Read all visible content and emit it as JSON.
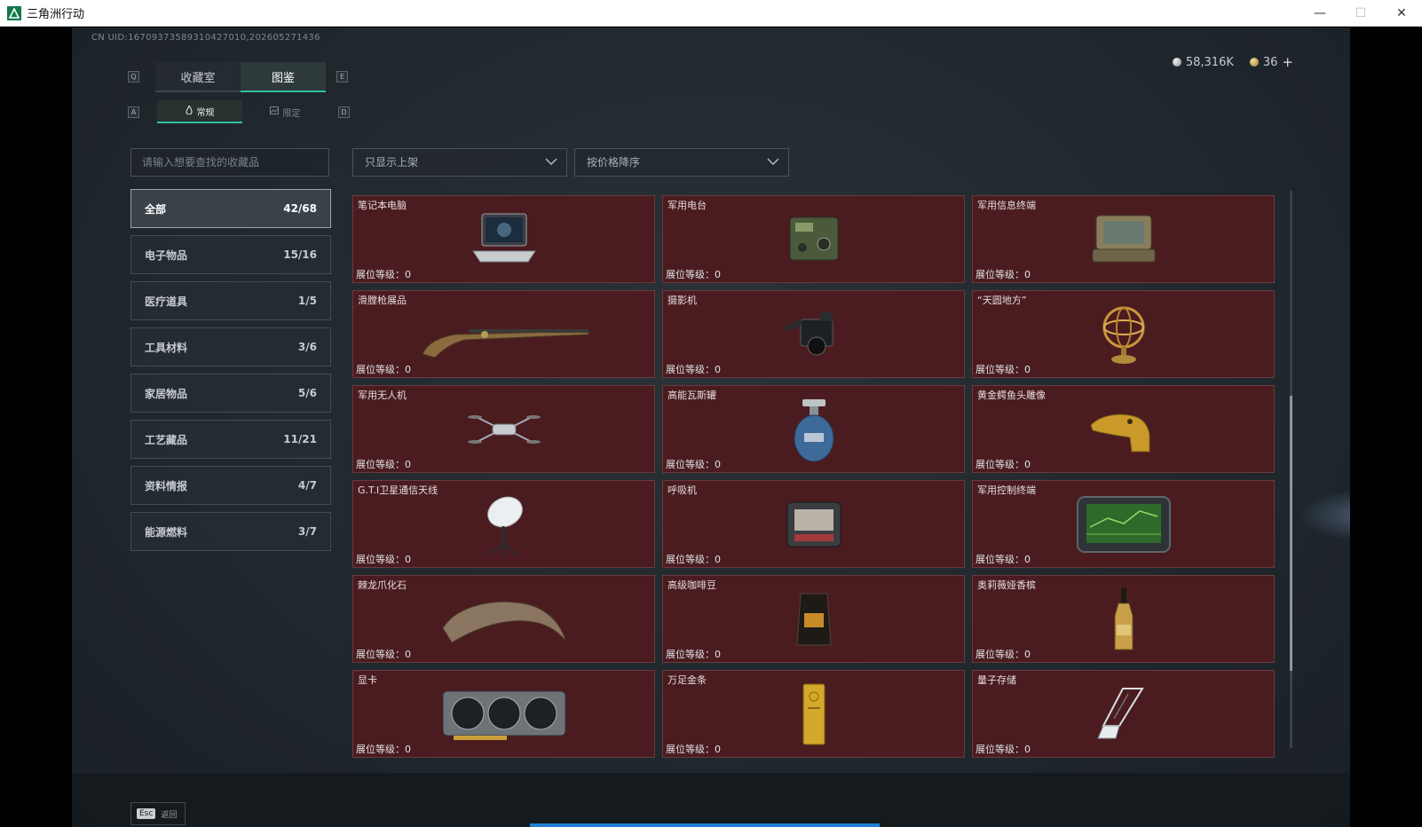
{
  "window": {
    "title": "三角洲行动",
    "minimize": "—",
    "maximize": "☐",
    "close": "✕"
  },
  "uid": "CN UID:16709373589310427010,202605271436",
  "currency": {
    "silver": "58,316K",
    "gold": "36",
    "add": "+"
  },
  "keyhints": {
    "left_tab": "Q",
    "right_tab": "E",
    "left_sub": "A",
    "right_sub": "D"
  },
  "tabs": [
    {
      "label": "收藏室",
      "active": false
    },
    {
      "label": "图鉴",
      "active": true
    }
  ],
  "subtabs": [
    {
      "label": "常规",
      "active": true
    },
    {
      "label": "限定",
      "active": false
    }
  ],
  "search": {
    "placeholder": "请输入想要查找的收藏品"
  },
  "filters": {
    "display": "只显示上架",
    "sort": "按价格降序"
  },
  "categories": [
    {
      "label": "全部",
      "count": "42/68",
      "active": true
    },
    {
      "label": "电子物品",
      "count": "15/16"
    },
    {
      "label": "医疗道具",
      "count": "1/5"
    },
    {
      "label": "工具材料",
      "count": "3/6"
    },
    {
      "label": "家居物品",
      "count": "5/6"
    },
    {
      "label": "工艺藏品",
      "count": "11/21"
    },
    {
      "label": "资料情报",
      "count": "4/7"
    },
    {
      "label": "能源燃料",
      "count": "3/7"
    }
  ],
  "items": [
    {
      "name": "笔记本电脑",
      "level": "展位等级：0",
      "icon": "laptop-icon"
    },
    {
      "name": "军用电台",
      "level": "展位等级：0",
      "icon": "radio-icon"
    },
    {
      "name": "军用信息终端",
      "level": "展位等级：0",
      "icon": "terminal-icon"
    },
    {
      "name": "滑膛枪展品",
      "level": "展位等级：0",
      "icon": "musket-icon"
    },
    {
      "name": "摄影机",
      "level": "展位等级：0",
      "icon": "camera-icon"
    },
    {
      "name": "“天圆地方”",
      "level": "展位等级：0",
      "icon": "armillary-icon"
    },
    {
      "name": "军用无人机",
      "level": "展位等级：0",
      "icon": "drone-icon"
    },
    {
      "name": "高能瓦斯罐",
      "level": "展位等级：0",
      "icon": "gas-can-icon"
    },
    {
      "name": "黄金鳄鱼头雕像",
      "level": "展位等级：0",
      "icon": "croc-statue-icon"
    },
    {
      "name": "G.T.I卫星通信天线",
      "level": "展位等级：0",
      "icon": "satellite-dish-icon"
    },
    {
      "name": "呼吸机",
      "level": "展位等级：0",
      "icon": "ventilator-icon"
    },
    {
      "name": "军用控制终端",
      "level": "展位等级：0",
      "icon": "control-terminal-icon"
    },
    {
      "name": "棘龙爪化石",
      "level": "展位等级：0",
      "icon": "claw-fossil-icon"
    },
    {
      "name": "高级咖啡豆",
      "level": "展位等级：0",
      "icon": "coffee-bag-icon"
    },
    {
      "name": "奥莉薇娅香槟",
      "level": "展位等级：0",
      "icon": "champagne-icon"
    },
    {
      "name": "显卡",
      "level": "展位等级：0",
      "icon": "gpu-icon"
    },
    {
      "name": "万足金条",
      "level": "展位等级：0",
      "icon": "gold-bar-icon"
    },
    {
      "name": "量子存储",
      "level": "展位等级：0",
      "icon": "usb-drive-icon"
    }
  ],
  "footer": {
    "esc_key": "Esc",
    "esc_label": "返回"
  },
  "colors": {
    "accent": "#2fc39a",
    "card_bg": "#4a1c20",
    "loadbar": "#1f7fd4"
  }
}
